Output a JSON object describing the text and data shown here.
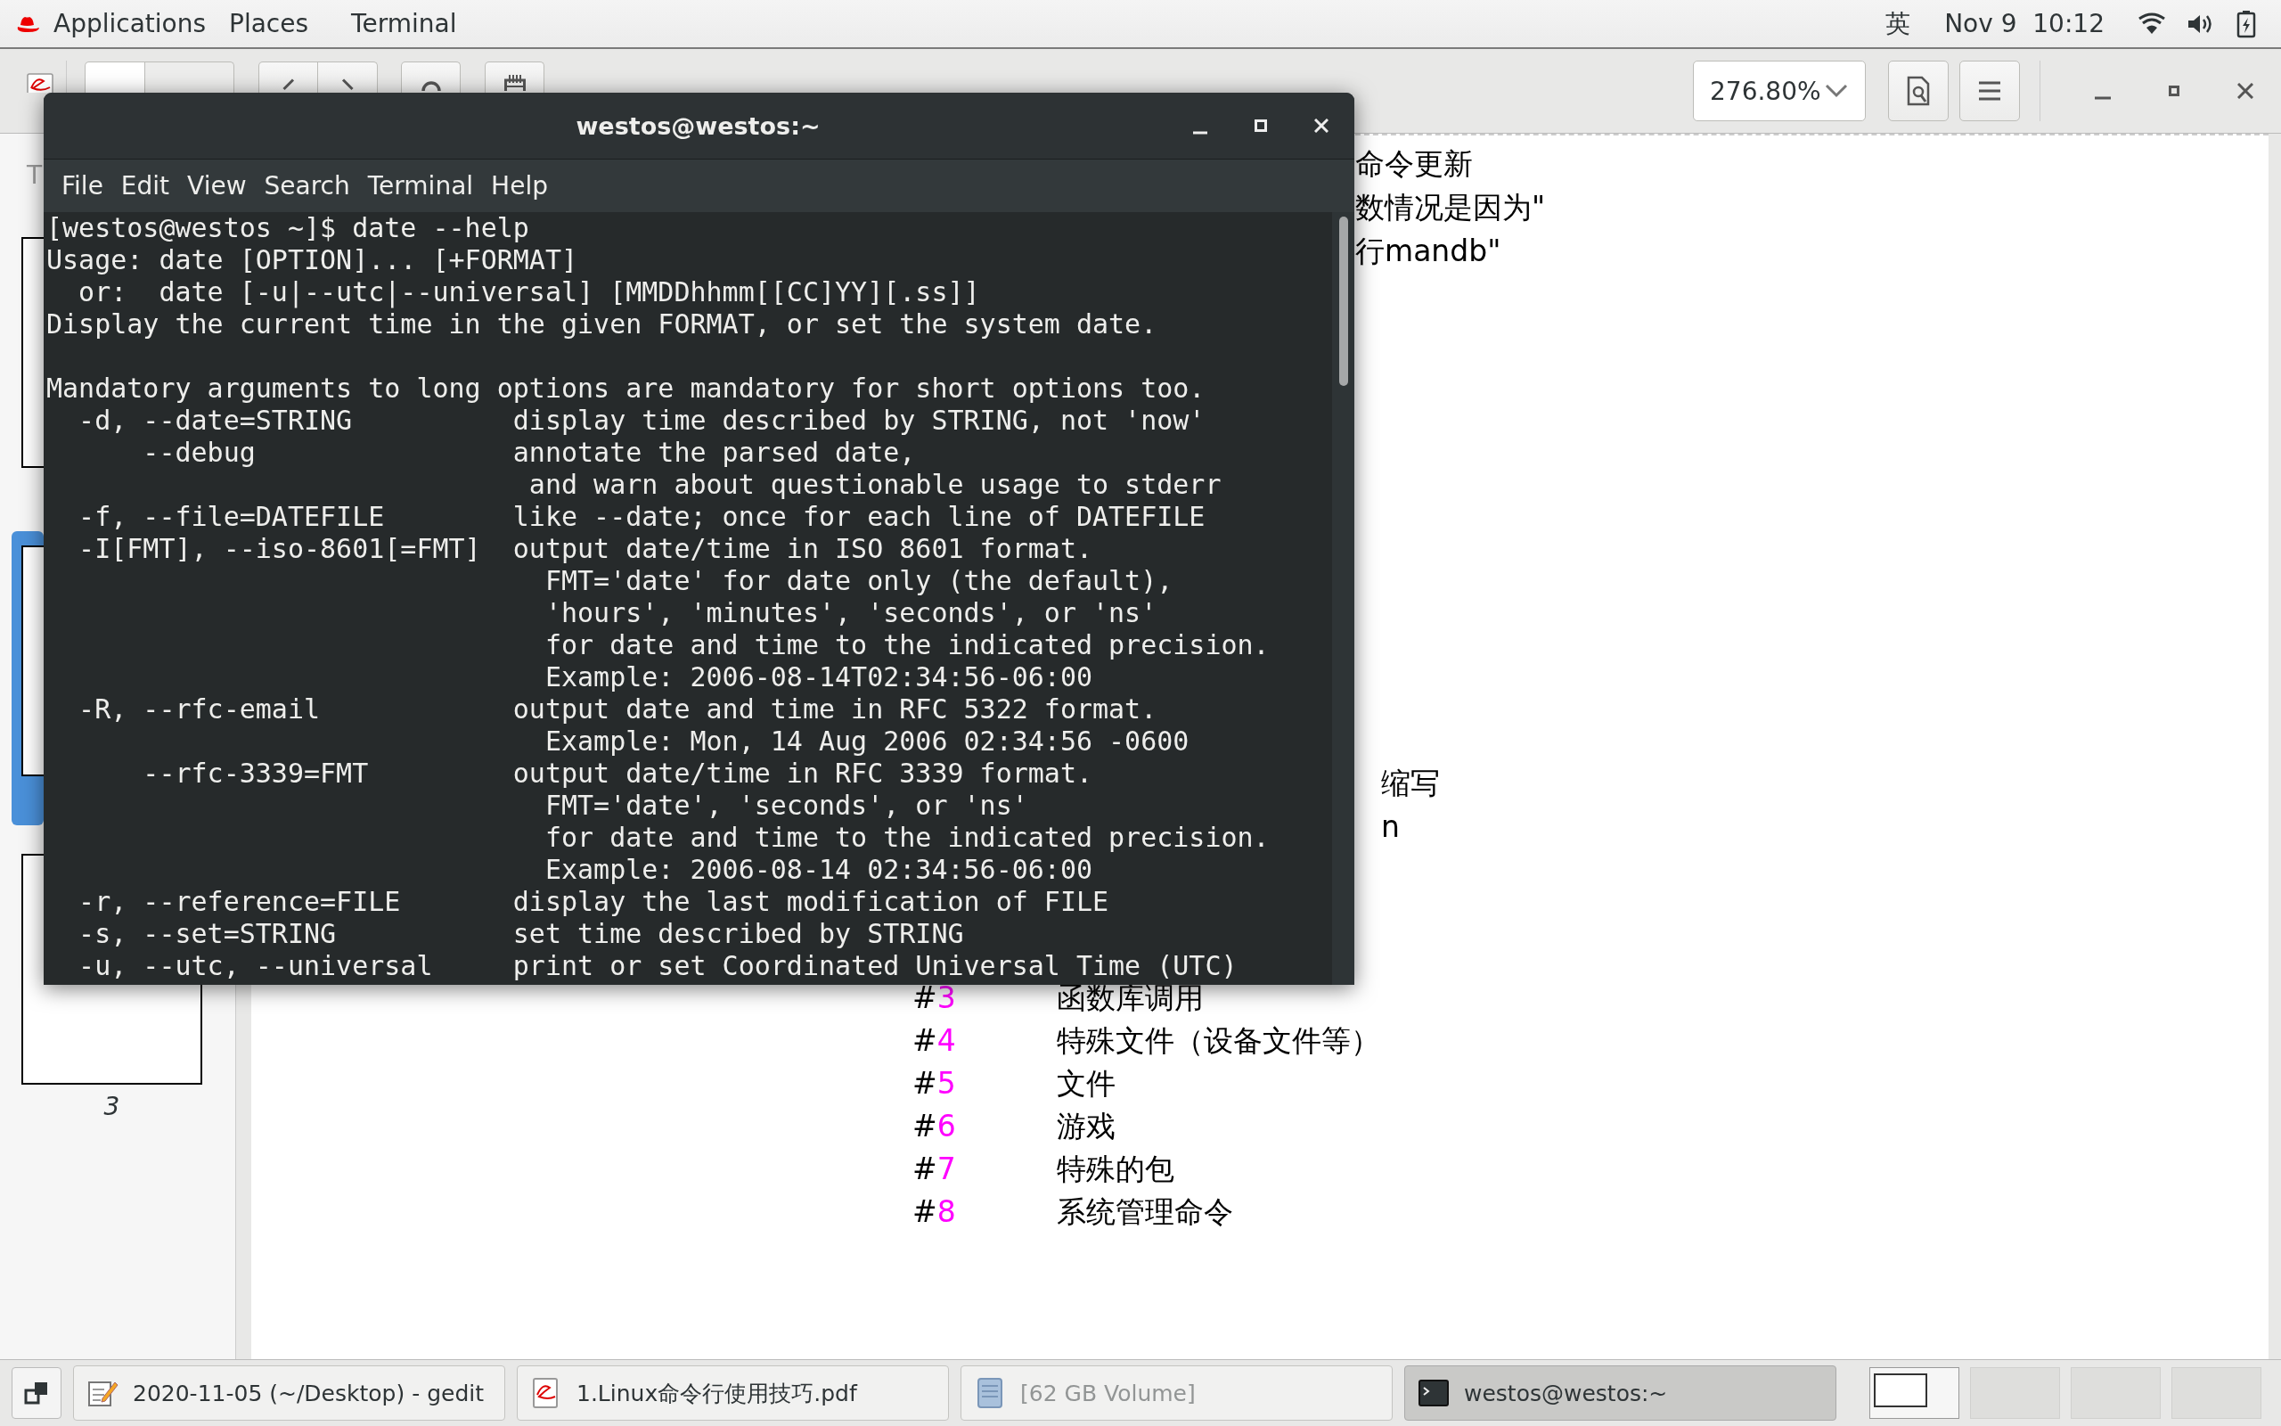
{
  "top_bar": {
    "menus": [
      "Applications",
      "Places",
      "Terminal"
    ],
    "input_method": "英",
    "clock": "Nov 9  10:12"
  },
  "pdf_viewer": {
    "zoom": "276.80%",
    "sidebar_header": "T",
    "thumbnails": [
      {
        "selected": false
      },
      {
        "selected": true
      },
      {
        "selected": false,
        "label": "3"
      }
    ],
    "page_blocks": [
      {
        "lines": [
          "命令更新",
          "数情况是因为\"",
          "行mandb\""
        ]
      },
      {
        "lines": [
          "缩写",
          "n"
        ]
      }
    ],
    "table_rows": [
      {
        "prefix": "#",
        "number": "3",
        "text": "函数库调用"
      },
      {
        "prefix": "#",
        "number": "4",
        "text": "特殊文件（设备文件等）"
      },
      {
        "prefix": "#",
        "number": "5",
        "text": "文件"
      },
      {
        "prefix": "#",
        "number": "6",
        "text": "游戏"
      },
      {
        "prefix": "#",
        "number": "7",
        "text": "特殊的包"
      },
      {
        "prefix": "#",
        "number": "8",
        "text": "系统管理命令"
      }
    ]
  },
  "terminal": {
    "title": "westos@westos:~",
    "menus": [
      "File",
      "Edit",
      "View",
      "Search",
      "Terminal",
      "Help"
    ],
    "blocks": [
      [
        "[westos@westos ~]$ date --help",
        "Usage: date [OPTION]... [+FORMAT]",
        "  or:  date [-u|--utc|--universal] [MMDDhhmm[[CC]YY][.ss]]",
        "Display the current time in the given FORMAT, or set the system date."
      ],
      [
        "Mandatory arguments to long options are mandatory for short options too.",
        "  -d, --date=STRING          display time described by STRING, not 'now'",
        "      --debug                annotate the parsed date,",
        "                              and warn about questionable usage to stderr",
        "  -f, --file=DATEFILE        like --date; once for each line of DATEFILE",
        "  -I[FMT], --iso-8601[=FMT]  output date/time in ISO 8601 format.",
        "                               FMT='date' for date only (the default),",
        "                               'hours', 'minutes', 'seconds', or 'ns'",
        "                               for date and time to the indicated precision.",
        "                               Example: 2006-08-14T02:34:56-06:00",
        "  -R, --rfc-email            output date and time in RFC 5322 format.",
        "                               Example: Mon, 14 Aug 2006 02:34:56 -0600",
        "      --rfc-3339=FMT         output date/time in RFC 3339 format.",
        "                               FMT='date', 'seconds', or 'ns'",
        "                               for date and time to the indicated precision.",
        "                               Example: 2006-08-14 02:34:56-06:00",
        "  -r, --reference=FILE       display the last modification of FILE",
        "  -s, --set=STRING           set time described by STRING",
        "  -u, --utc, --universal     print or set Coordinated Universal Time (UTC)"
      ]
    ]
  },
  "taskbar": {
    "tasks": [
      {
        "kind": "editor",
        "label": "2020-11-05 (~/Desktop) - gedit",
        "selected": false,
        "disabled": false
      },
      {
        "kind": "pdf",
        "label": "1.Linux命令行使用技巧.pdf",
        "selected": false,
        "disabled": false
      },
      {
        "kind": "drive",
        "label": "[62 GB Volume]",
        "selected": false,
        "disabled": true
      },
      {
        "kind": "terminal",
        "label": "westos@westos:~",
        "selected": true,
        "disabled": false
      }
    ],
    "workspaces": [
      {
        "selected": true
      },
      {
        "selected": false
      },
      {
        "selected": false
      },
      {
        "selected": false
      }
    ]
  }
}
